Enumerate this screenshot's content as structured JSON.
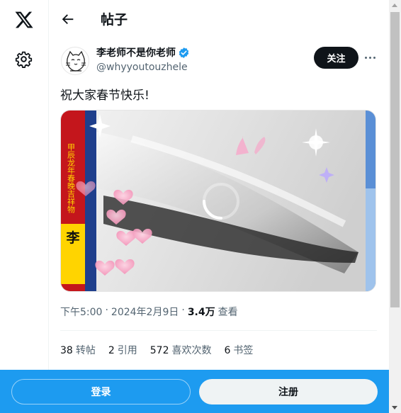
{
  "header": {
    "title": "帖子"
  },
  "post": {
    "author": {
      "display_name": "李老师不是你老师",
      "handle": "@whyyoutouzhele"
    },
    "follow_label": "关注",
    "text": "祝大家春节快乐!",
    "media": {
      "vertical_caption": "甲辰龙年春晚吉祥物",
      "name_block": "李",
      "loading": true
    },
    "meta": {
      "time": "下午5:00",
      "sep1": "·",
      "date": "2024年2月9日",
      "sep2": "·",
      "views_count": "3.4万",
      "views_label": "查看"
    },
    "stats": [
      {
        "value": "38",
        "label": "转帖"
      },
      {
        "value": "2",
        "label": "引用"
      },
      {
        "value": "572",
        "label": "喜欢次数"
      },
      {
        "value": "6",
        "label": "书签"
      }
    ]
  },
  "bottom_bar": {
    "login_label": "登录",
    "signup_label": "注册"
  },
  "colors": {
    "brand": "#1d9bf0",
    "text": "#0f1419",
    "secondary": "#536471"
  }
}
